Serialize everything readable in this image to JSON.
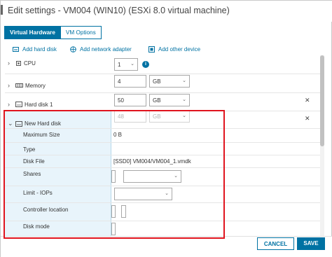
{
  "dialog": {
    "title": "Edit settings - VM004 (WIN10) (ESXi 8.0 virtual machine)"
  },
  "tabs": [
    {
      "label": "Virtual Hardware",
      "active": true
    },
    {
      "label": "VM Options",
      "active": false
    }
  ],
  "actions": {
    "add_hard_disk": "Add hard disk",
    "add_network_adapter": "Add network adapter",
    "add_other_device": "Add other device"
  },
  "devices": {
    "cpu": {
      "label": "CPU",
      "value": "1",
      "icon": "cpu-icon"
    },
    "memory": {
      "label": "Memory",
      "value": "4",
      "unit": "GB",
      "icon": "memory-icon"
    },
    "hard_disk_1": {
      "label": "Hard disk 1",
      "value": "50",
      "unit": "GB",
      "icon": "disk-icon"
    },
    "new_hard_disk": {
      "label": "New Hard disk",
      "value": "48",
      "unit": "GB",
      "icon": "disk-icon",
      "fields": {
        "maximum_size_label": "Maximum Size",
        "maximum_size_value": "0 B",
        "type_label": "Type",
        "disk_file_label": "Disk File",
        "disk_file_value": "[SSD0] VM004/VM004_1.vmdk",
        "shares_label": "Shares",
        "limit_iops_label": "Limit - IOPs",
        "controller_location_label": "Controller location",
        "disk_mode_label": "Disk mode"
      }
    }
  },
  "footer": {
    "cancel_label": "CANCEL",
    "save_label": "SAVE"
  },
  "colors": {
    "accent": "#0072a3",
    "highlight_box": "#e0141e",
    "selected_section_bg": "#e8f4fb"
  }
}
